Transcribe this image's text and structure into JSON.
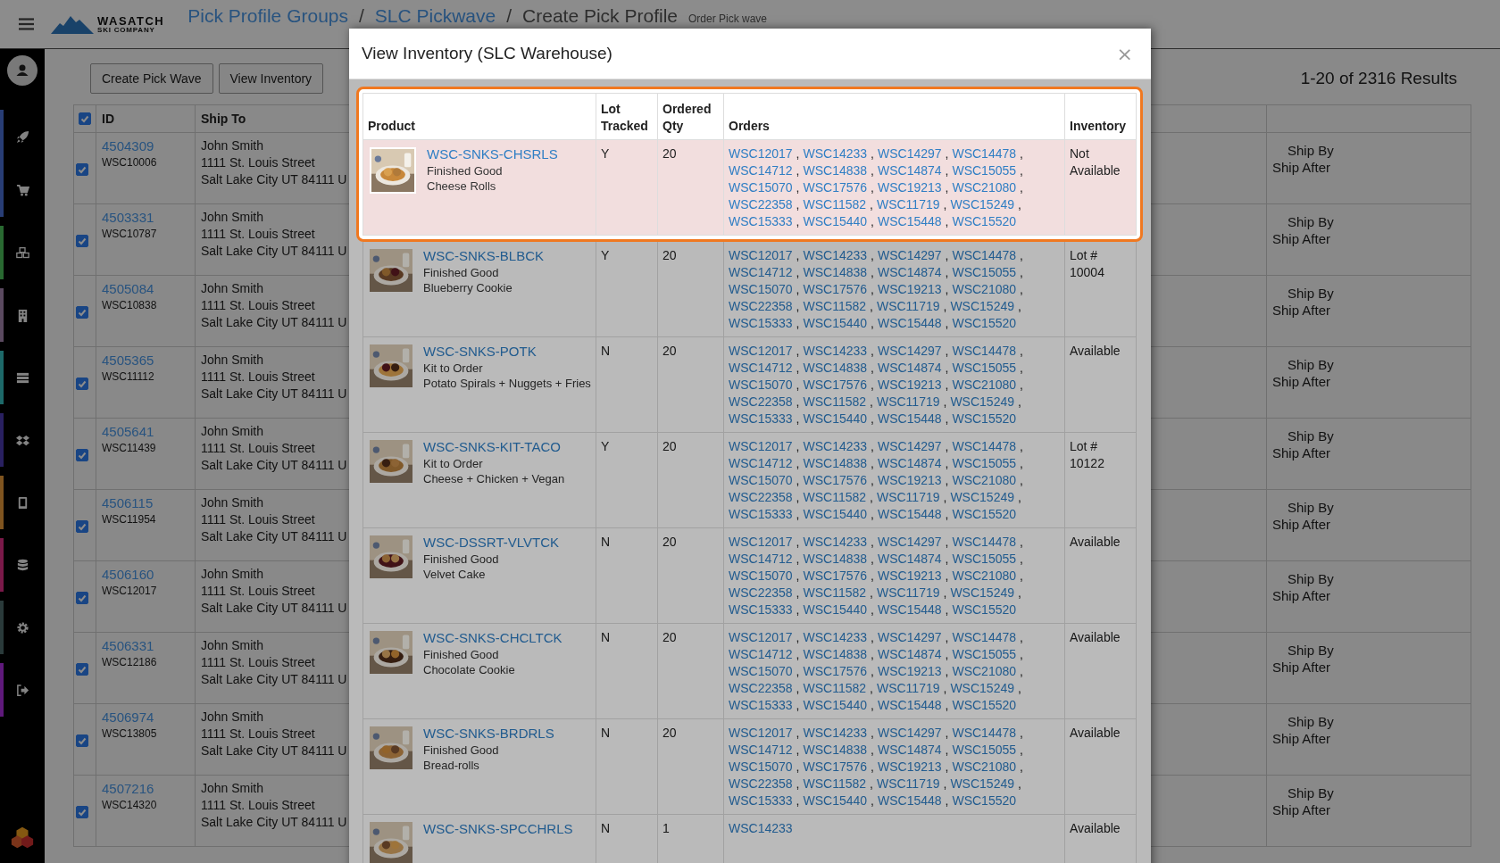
{
  "header": {
    "logo": {
      "line1": "WASATCH",
      "line2": "SKI COMPANY"
    },
    "breadcrumb": [
      {
        "label": "Pick Profile Groups",
        "kind": "link"
      },
      {
        "label": "/",
        "kind": "separator"
      },
      {
        "label": "SLC Pickwave",
        "kind": "link"
      },
      {
        "label": "/",
        "kind": "separator"
      },
      {
        "label": "Create Pick Profile",
        "kind": "current"
      }
    ],
    "subtitle": "Order Pick wave"
  },
  "toolbar": {
    "buttons": [
      "Create Pick Wave",
      "View Inventory"
    ],
    "results": "1-20 of 2316 Results"
  },
  "table": {
    "select_all_checked": true,
    "columns": [
      "ID",
      "Ship To"
    ],
    "rows": [
      {
        "checked": true,
        "id": "4504309",
        "order": "WSC10006",
        "name": "John Smith",
        "street": "1111 St. Louis Street",
        "city": "Salt Lake City UT 84111 U",
        "ship_by": "Ship By",
        "ship_after": "Ship After"
      },
      {
        "checked": true,
        "id": "4503331",
        "order": "WSC10787",
        "name": "John Smith",
        "street": "1111 St. Louis Street",
        "city": "Salt Lake City UT 84111 U",
        "ship_by": "Ship By",
        "ship_after": "Ship After"
      },
      {
        "checked": true,
        "id": "4505084",
        "order": "WSC10838",
        "name": "John Smith",
        "street": "1111 St. Louis Street",
        "city": "Salt Lake City UT 84111 U",
        "ship_by": "Ship By",
        "ship_after": "Ship After"
      },
      {
        "checked": true,
        "id": "4505365",
        "order": "WSC11112",
        "name": "John Smith",
        "street": "1111 St. Louis Street",
        "city": "Salt Lake City UT 84111 U",
        "ship_by": "Ship By",
        "ship_after": "Ship After"
      },
      {
        "checked": true,
        "id": "4505641",
        "order": "WSC11439",
        "name": "John Smith",
        "street": "1111 St. Louis Street",
        "city": "Salt Lake City UT 84111 U",
        "ship_by": "Ship By",
        "ship_after": "Ship After"
      },
      {
        "checked": true,
        "id": "4506115",
        "order": "WSC11954",
        "name": "John Smith",
        "street": "1111 St. Louis Street",
        "city": "Salt Lake City UT 84111 U",
        "ship_by": "Ship By",
        "ship_after": "Ship After"
      },
      {
        "checked": true,
        "id": "4506160",
        "order": "WSC12017",
        "name": "John Smith",
        "street": "1111 St. Louis Street",
        "city": "Salt Lake City UT 84111 U",
        "ship_by": "Ship By",
        "ship_after": "Ship After"
      },
      {
        "checked": true,
        "id": "4506331",
        "order": "WSC12186",
        "name": "John Smith",
        "street": "1111 St. Louis Street",
        "city": "Salt Lake City UT 84111 U",
        "ship_by": "Ship By",
        "ship_after": "Ship After"
      },
      {
        "checked": true,
        "id": "4506974",
        "order": "WSC13805",
        "name": "John Smith",
        "street": "1111 St. Louis Street",
        "city": "Salt Lake City UT 84111 U",
        "ship_by": "Ship By",
        "ship_after": "Ship After"
      },
      {
        "checked": true,
        "id": "4507216",
        "order": "WSC14320",
        "name": "John Smith",
        "street": "1111 St. Louis Street",
        "city": "Salt Lake City UT 84111 U",
        "ship_by": "Ship By",
        "ship_after": "Ship After"
      }
    ]
  },
  "modal": {
    "title": "View Inventory (SLC Warehouse)",
    "close": "×",
    "columns": [
      "Product",
      "Lot Tracked",
      "Ordered Qty",
      "Orders",
      "Inventory"
    ],
    "rows": [
      {
        "highlighted": true,
        "sku": "WSC-SNKS-CHSRLS",
        "type": "Finished Good",
        "name": "Cheese Rolls",
        "lot_tracked": "Y",
        "ordered_qty": "20",
        "inventory": "Not Available",
        "orders": [
          {
            "id": "WSC12017",
            "sep": ","
          },
          {
            "id": "WSC14233",
            "sep": ","
          },
          {
            "id": "WSC14297",
            "sep": ","
          },
          {
            "id": "WSC14478",
            "sep": ","
          },
          {
            "id": "WSC14712",
            "sep": ","
          },
          {
            "id": "WSC14838",
            "sep": ","
          },
          {
            "id": "WSC14874",
            "sep": ","
          },
          {
            "id": "WSC15055",
            "sep": ","
          },
          {
            "id": "WSC15070",
            "sep": ","
          },
          {
            "id": "WSC17576",
            "sep": ","
          },
          {
            "id": "WSC19213",
            "sep": ","
          },
          {
            "id": "WSC21080",
            "sep": ","
          },
          {
            "id": "WSC22358",
            "sep": ","
          },
          {
            "id": "WSC11582",
            "sep": ","
          },
          {
            "id": "WSC11719",
            "sep": ","
          },
          {
            "id": "WSC15249",
            "sep": ","
          },
          {
            "id": "WSC15333",
            "sep": ","
          },
          {
            "id": "WSC15440",
            "sep": ","
          },
          {
            "id": "WSC15448",
            "sep": ","
          },
          {
            "id": "WSC15520"
          }
        ]
      },
      {
        "highlighted": false,
        "sku": "WSC-SNKS-BLBCK",
        "type": "Finished Good",
        "name": "Blueberry Cookie",
        "lot_tracked": "Y",
        "ordered_qty": "20",
        "inventory": "Lot # 10004",
        "orders": [
          {
            "id": "WSC12017",
            "sep": ","
          },
          {
            "id": "WSC14233",
            "sep": ","
          },
          {
            "id": "WSC14297",
            "sep": ","
          },
          {
            "id": "WSC14478",
            "sep": ","
          },
          {
            "id": "WSC14712",
            "sep": ","
          },
          {
            "id": "WSC14838",
            "sep": ","
          },
          {
            "id": "WSC14874",
            "sep": ","
          },
          {
            "id": "WSC15055",
            "sep": ","
          },
          {
            "id": "WSC15070",
            "sep": ","
          },
          {
            "id": "WSC17576",
            "sep": ","
          },
          {
            "id": "WSC19213",
            "sep": ","
          },
          {
            "id": "WSC21080",
            "sep": ","
          },
          {
            "id": "WSC22358",
            "sep": ","
          },
          {
            "id": "WSC11582",
            "sep": ","
          },
          {
            "id": "WSC11719",
            "sep": ","
          },
          {
            "id": "WSC15249",
            "sep": ","
          },
          {
            "id": "WSC15333",
            "sep": ","
          },
          {
            "id": "WSC15440",
            "sep": ","
          },
          {
            "id": "WSC15448",
            "sep": ","
          },
          {
            "id": "WSC15520"
          }
        ]
      },
      {
        "highlighted": false,
        "sku": "WSC-SNKS-POTK",
        "type": "Kit to Order",
        "name": "Potato Spirals + Nuggets + Fries",
        "lot_tracked": "N",
        "ordered_qty": "20",
        "inventory": "Available",
        "orders": [
          {
            "id": "WSC12017",
            "sep": ","
          },
          {
            "id": "WSC14233",
            "sep": ","
          },
          {
            "id": "WSC14297",
            "sep": ","
          },
          {
            "id": "WSC14478",
            "sep": ","
          },
          {
            "id": "WSC14712",
            "sep": ","
          },
          {
            "id": "WSC14838",
            "sep": ","
          },
          {
            "id": "WSC14874",
            "sep": ","
          },
          {
            "id": "WSC15055",
            "sep": ","
          },
          {
            "id": "WSC15070",
            "sep": ","
          },
          {
            "id": "WSC17576",
            "sep": ","
          },
          {
            "id": "WSC19213",
            "sep": ","
          },
          {
            "id": "WSC21080",
            "sep": ","
          },
          {
            "id": "WSC22358",
            "sep": ","
          },
          {
            "id": "WSC11582",
            "sep": ","
          },
          {
            "id": "WSC11719",
            "sep": ","
          },
          {
            "id": "WSC15249",
            "sep": ","
          },
          {
            "id": "WSC15333",
            "sep": ","
          },
          {
            "id": "WSC15440",
            "sep": ","
          },
          {
            "id": "WSC15448",
            "sep": ","
          },
          {
            "id": "WSC15520"
          }
        ]
      },
      {
        "highlighted": false,
        "sku": "WSC-SNKS-KIT-TACO",
        "type": "Kit to Order",
        "name": "Cheese + Chicken + Vegan",
        "lot_tracked": "Y",
        "ordered_qty": "20",
        "inventory": "Lot # 10122",
        "orders": [
          {
            "id": "WSC12017",
            "sep": ","
          },
          {
            "id": "WSC14233",
            "sep": ","
          },
          {
            "id": "WSC14297",
            "sep": ","
          },
          {
            "id": "WSC14478",
            "sep": ","
          },
          {
            "id": "WSC14712",
            "sep": ","
          },
          {
            "id": "WSC14838",
            "sep": ","
          },
          {
            "id": "WSC14874",
            "sep": ","
          },
          {
            "id": "WSC15055",
            "sep": ","
          },
          {
            "id": "WSC15070",
            "sep": ","
          },
          {
            "id": "WSC17576",
            "sep": ","
          },
          {
            "id": "WSC19213",
            "sep": ","
          },
          {
            "id": "WSC21080",
            "sep": ","
          },
          {
            "id": "WSC22358",
            "sep": ","
          },
          {
            "id": "WSC11582",
            "sep": ","
          },
          {
            "id": "WSC11719",
            "sep": ","
          },
          {
            "id": "WSC15249",
            "sep": ","
          },
          {
            "id": "WSC15333",
            "sep": ","
          },
          {
            "id": "WSC15440",
            "sep": ","
          },
          {
            "id": "WSC15448",
            "sep": ","
          },
          {
            "id": "WSC15520"
          }
        ]
      },
      {
        "highlighted": false,
        "sku": "WSC-DSSRT-VLVTCK",
        "type": "Finished Good",
        "name": "Velvet Cake",
        "lot_tracked": "N",
        "ordered_qty": "20",
        "inventory": "Available",
        "orders": [
          {
            "id": "WSC12017",
            "sep": ","
          },
          {
            "id": "WSC14233",
            "sep": ","
          },
          {
            "id": "WSC14297",
            "sep": ","
          },
          {
            "id": "WSC14478",
            "sep": ","
          },
          {
            "id": "WSC14712",
            "sep": ","
          },
          {
            "id": "WSC14838",
            "sep": ","
          },
          {
            "id": "WSC14874",
            "sep": ","
          },
          {
            "id": "WSC15055",
            "sep": ","
          },
          {
            "id": "WSC15070",
            "sep": ","
          },
          {
            "id": "WSC17576",
            "sep": ","
          },
          {
            "id": "WSC19213",
            "sep": ","
          },
          {
            "id": "WSC21080",
            "sep": ","
          },
          {
            "id": "WSC22358",
            "sep": ","
          },
          {
            "id": "WSC11582",
            "sep": ","
          },
          {
            "id": "WSC11719",
            "sep": ","
          },
          {
            "id": "WSC15249",
            "sep": ","
          },
          {
            "id": "WSC15333",
            "sep": ","
          },
          {
            "id": "WSC15440",
            "sep": ","
          },
          {
            "id": "WSC15448",
            "sep": ","
          },
          {
            "id": "WSC15520"
          }
        ]
      },
      {
        "highlighted": false,
        "sku": "WSC-SNKS-CHCLTCK",
        "type": "Finished Good",
        "name": "Chocolate Cookie",
        "lot_tracked": "N",
        "ordered_qty": "20",
        "inventory": "Available",
        "orders": [
          {
            "id": "WSC12017",
            "sep": ","
          },
          {
            "id": "WSC14233",
            "sep": ","
          },
          {
            "id": "WSC14297",
            "sep": ","
          },
          {
            "id": "WSC14478",
            "sep": ","
          },
          {
            "id": "WSC14712",
            "sep": ","
          },
          {
            "id": "WSC14838",
            "sep": ","
          },
          {
            "id": "WSC14874",
            "sep": ","
          },
          {
            "id": "WSC15055",
            "sep": ","
          },
          {
            "id": "WSC15070",
            "sep": ","
          },
          {
            "id": "WSC17576",
            "sep": ","
          },
          {
            "id": "WSC19213",
            "sep": ","
          },
          {
            "id": "WSC21080",
            "sep": ","
          },
          {
            "id": "WSC22358",
            "sep": ","
          },
          {
            "id": "WSC11582",
            "sep": ","
          },
          {
            "id": "WSC11719",
            "sep": ","
          },
          {
            "id": "WSC15249",
            "sep": ","
          },
          {
            "id": "WSC15333",
            "sep": ","
          },
          {
            "id": "WSC15440",
            "sep": ","
          },
          {
            "id": "WSC15448",
            "sep": ","
          },
          {
            "id": "WSC15520"
          }
        ]
      },
      {
        "highlighted": false,
        "sku": "WSC-SNKS-BRDRLS",
        "type": "Finished Good",
        "name": "Bread-rolls",
        "lot_tracked": "N",
        "ordered_qty": "20",
        "inventory": "Available",
        "orders": [
          {
            "id": "WSC12017",
            "sep": ","
          },
          {
            "id": "WSC14233",
            "sep": ","
          },
          {
            "id": "WSC14297",
            "sep": ","
          },
          {
            "id": "WSC14478",
            "sep": ","
          },
          {
            "id": "WSC14712",
            "sep": ","
          },
          {
            "id": "WSC14838",
            "sep": ","
          },
          {
            "id": "WSC14874",
            "sep": ","
          },
          {
            "id": "WSC15055",
            "sep": ","
          },
          {
            "id": "WSC15070",
            "sep": ","
          },
          {
            "id": "WSC17576",
            "sep": ","
          },
          {
            "id": "WSC19213",
            "sep": ","
          },
          {
            "id": "WSC21080",
            "sep": ","
          },
          {
            "id": "WSC22358",
            "sep": ","
          },
          {
            "id": "WSC11582",
            "sep": ","
          },
          {
            "id": "WSC11719",
            "sep": ","
          },
          {
            "id": "WSC15249",
            "sep": ","
          },
          {
            "id": "WSC15333",
            "sep": ","
          },
          {
            "id": "WSC15440",
            "sep": ","
          },
          {
            "id": "WSC15448",
            "sep": ","
          },
          {
            "id": "WSC15520"
          }
        ]
      },
      {
        "highlighted": false,
        "sku": "WSC-SNKS-SPCCHRLS",
        "lot_tracked": "N",
        "ordered_qty": "1",
        "inventory": "Available",
        "orders": [
          {
            "id": "WSC14233"
          }
        ]
      }
    ]
  }
}
